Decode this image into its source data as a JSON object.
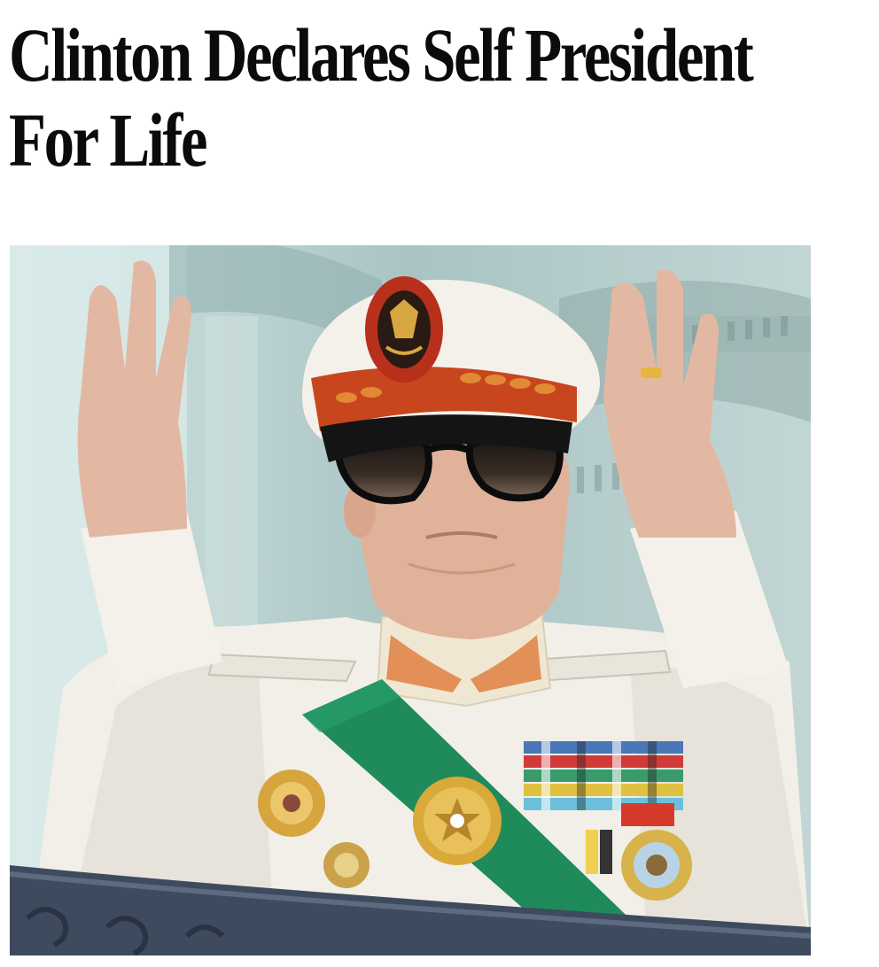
{
  "article": {
    "headline_line1": "Clinton Declares Self President",
    "headline_line2": "For Life"
  },
  "photo": {
    "subject": "man in white military dress uniform with peaked cap, dark sunglasses, green sash and medals, both arms raised on a balcony",
    "colors": {
      "uniform": "#f1efe8",
      "sash": "#1f8a5a",
      "cap_band": "#c8461e",
      "background": "#bcd3d2",
      "railing": "#3e4a5e",
      "skin": "#e3b8a2"
    }
  }
}
